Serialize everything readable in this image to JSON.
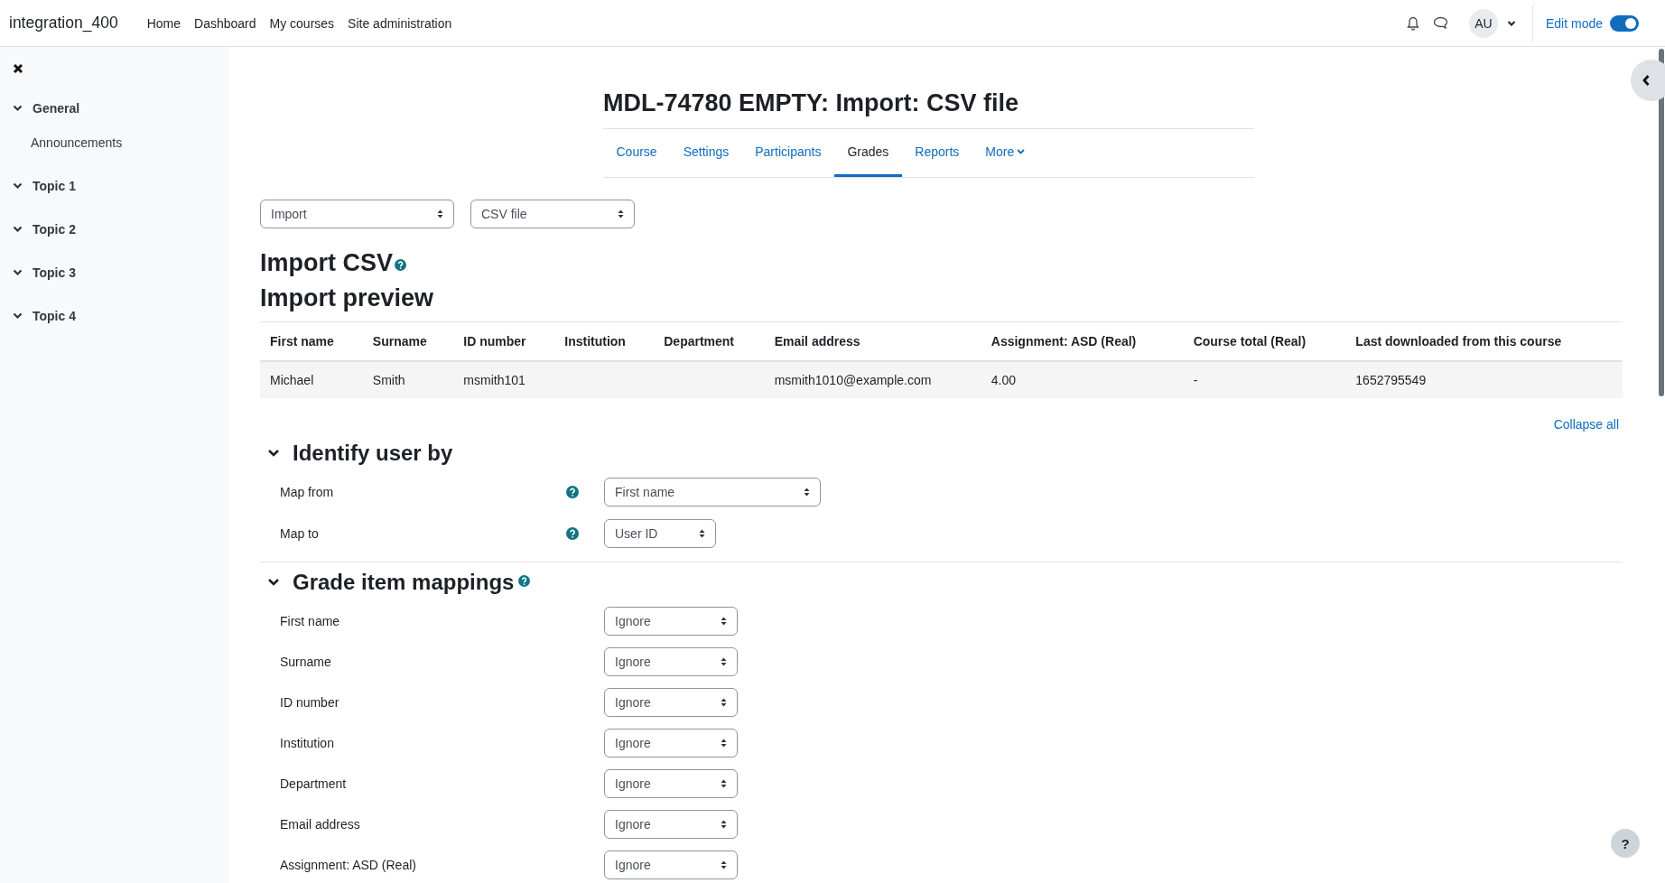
{
  "site_name": "integration_400",
  "nav": [
    "Home",
    "Dashboard",
    "My courses",
    "Site administration"
  ],
  "user": {
    "initials": "AU"
  },
  "edit_mode": {
    "label": "Edit mode",
    "on": true
  },
  "course_index": [
    {
      "label": "General",
      "expanded": true,
      "children": [
        {
          "label": "Announcements"
        }
      ]
    },
    {
      "label": "Topic 1",
      "expanded": true
    },
    {
      "label": "Topic 2",
      "expanded": true
    },
    {
      "label": "Topic 3",
      "expanded": true
    },
    {
      "label": "Topic 4",
      "expanded": true
    }
  ],
  "page_title": "MDL-74780 EMPTY: Import: CSV file",
  "tabs": [
    {
      "label": "Course",
      "selected": false,
      "kind": "link"
    },
    {
      "label": "Settings",
      "selected": false,
      "kind": "link"
    },
    {
      "label": "Participants",
      "selected": false,
      "kind": "link"
    },
    {
      "label": "Grades",
      "selected": true,
      "kind": "link"
    },
    {
      "label": "Reports",
      "selected": false,
      "kind": "link"
    },
    {
      "label": "More",
      "selected": false,
      "kind": "menu"
    }
  ],
  "selectors": [
    "Import",
    "CSV file"
  ],
  "heading": "Import CSV",
  "preview_heading": "Import preview",
  "preview_table": {
    "columns": [
      "First name",
      "Surname",
      "ID number",
      "Institution",
      "Department",
      "Email address",
      "Assignment: ASD (Real)",
      "Course total (Real)",
      "Last downloaded from this course"
    ],
    "rows": [
      [
        "Michael",
        "Smith",
        "msmith101",
        null,
        null,
        "msmith1010@example.com",
        "4.00",
        "-",
        "1652795549"
      ]
    ]
  },
  "collapse_all": "Collapse all",
  "sections": [
    {
      "title": "Identify user by",
      "expanded": true,
      "help": false,
      "fields": [
        {
          "label": "Map from",
          "help": true,
          "value": "First name"
        },
        {
          "label": "Map to",
          "help": true,
          "value": "User ID"
        }
      ]
    },
    {
      "title": "Grade item mappings",
      "expanded": true,
      "help": true,
      "fields": [
        {
          "label": "First name",
          "help": false,
          "value": "Ignore"
        },
        {
          "label": "Surname",
          "help": false,
          "value": "Ignore"
        },
        {
          "label": "ID number",
          "help": false,
          "value": "Ignore"
        },
        {
          "label": "Institution",
          "help": false,
          "value": "Ignore"
        },
        {
          "label": "Department",
          "help": false,
          "value": "Ignore"
        },
        {
          "label": "Email address",
          "help": false,
          "value": "Ignore"
        },
        {
          "label": "Assignment: ASD (Real)",
          "help": false,
          "value": "Ignore"
        }
      ]
    }
  ],
  "help_button": "?"
}
